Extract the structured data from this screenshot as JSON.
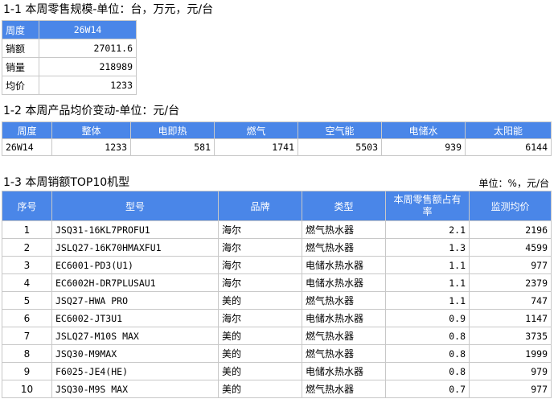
{
  "section1": {
    "title": "1-1 本周零售规模-单位：台，万元，元/台",
    "header": [
      "周度",
      "26W14"
    ],
    "rows": [
      {
        "label": "销额",
        "value": "27011.6"
      },
      {
        "label": "销量",
        "value": "218989"
      },
      {
        "label": "均价",
        "value": "1233"
      }
    ]
  },
  "section2": {
    "title": "1-2 本周产品均价变动-单位：元/台",
    "headers": [
      "周度",
      "整体",
      "电即热",
      "燃气",
      "空气能",
      "电储水",
      "太阳能"
    ],
    "row": [
      "26W14",
      "1233",
      "581",
      "1741",
      "5503",
      "939",
      "6144"
    ]
  },
  "section3": {
    "title": "1-3 本周销额TOP10机型",
    "unit": "单位：%，元/台",
    "headers": [
      "序号",
      "型号",
      "品牌",
      "类型",
      "本周零售额占有率",
      "监测均价"
    ],
    "rows": [
      [
        "1",
        "JSQ31-16KL7PROFU1",
        "海尔",
        "燃气热水器",
        "2.1",
        "2196"
      ],
      [
        "2",
        "JSLQ27-16K70HMAXFU1",
        "海尔",
        "燃气热水器",
        "1.3",
        "4599"
      ],
      [
        "3",
        "EC6001-PD3(U1)",
        "海尔",
        "电储水热水器",
        "1.1",
        "977"
      ],
      [
        "4",
        "EC6002H-DR7PLUSAU1",
        "海尔",
        "电储水热水器",
        "1.1",
        "2379"
      ],
      [
        "5",
        "JSQ27-HWA PRO",
        "美的",
        "燃气热水器",
        "1.1",
        "747"
      ],
      [
        "6",
        "EC6002-JT3U1",
        "海尔",
        "电储水热水器",
        "0.9",
        "1147"
      ],
      [
        "7",
        "JSLQ27-M10S MAX",
        "美的",
        "燃气热水器",
        "0.8",
        "3735"
      ],
      [
        "8",
        "JSQ30-M9MAX",
        "美的",
        "燃气热水器",
        "0.8",
        "1999"
      ],
      [
        "9",
        "F6025-JE4(HE)",
        "美的",
        "电储水热水器",
        "0.8",
        "979"
      ],
      [
        "10",
        "JSQ30-M9S MAX",
        "美的",
        "燃气热水器",
        "0.7",
        "977"
      ]
    ]
  },
  "colors": {
    "header_bg": "#4a86e8",
    "header_text": "#ffffff",
    "border": "#c8c8c8"
  }
}
